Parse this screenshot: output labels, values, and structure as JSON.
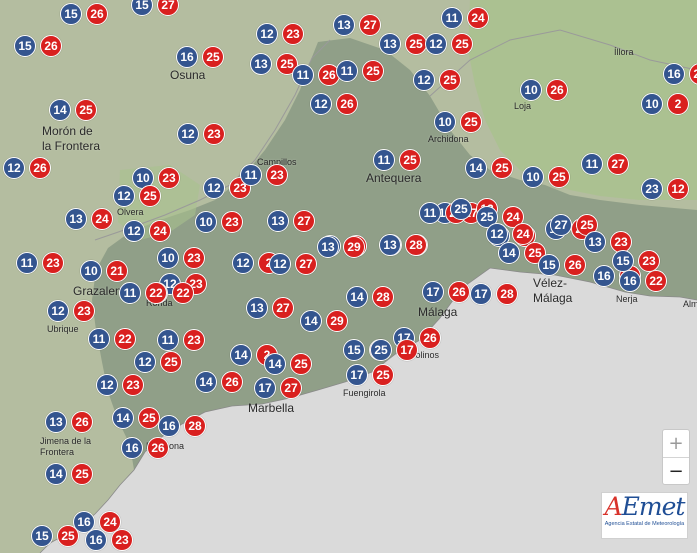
{
  "map": {
    "colors": {
      "sea": "#dadada",
      "land": "#b4bda0",
      "province": "#8c9b85",
      "highland": "#a9c28e",
      "border": "#9a9a9a",
      "min_marker": "#34558f",
      "max_marker": "#d9201f"
    },
    "town_labels": [
      "Osuna",
      "Morón de\nla Frontera",
      "Loja",
      "Íllora",
      "Archidona",
      "Campillos",
      "Antequera",
      "Olvera",
      "Grazalema",
      "Ronda",
      "Ubrique",
      "Vélez-\nMálaga",
      "Nerja",
      "Alm",
      "Málaga",
      "Molinos",
      "Marbella",
      "Fuengirola",
      "Jimena de la\nFrontera",
      "Estepona"
    ],
    "stations": [
      {
        "min": "15",
        "max": "26"
      },
      {
        "min": "15",
        "max": "27"
      },
      {
        "min": "15",
        "max": "26"
      },
      {
        "min": "16",
        "max": "25"
      },
      {
        "min": "12",
        "max": "23"
      },
      {
        "min": "13",
        "max": "27"
      },
      {
        "min": "11",
        "max": "24"
      },
      {
        "min": "13",
        "max": "25"
      },
      {
        "min": "12",
        "max": "25"
      },
      {
        "min": "16",
        "max": "25"
      },
      {
        "min": "13",
        "max": "25"
      },
      {
        "min": "11",
        "max": "26"
      },
      {
        "min": "11",
        "max": "25"
      },
      {
        "min": "12",
        "max": "25"
      },
      {
        "min": "10",
        "max": "26"
      },
      {
        "min": "10",
        "max": "2"
      },
      {
        "min": "14",
        "max": "25"
      },
      {
        "min": "12",
        "max": "26"
      },
      {
        "min": "10",
        "max": "25"
      },
      {
        "min": "12",
        "max": "23"
      },
      {
        "min": "11",
        "max": "25"
      },
      {
        "min": "12",
        "max": "26"
      },
      {
        "min": "14",
        "max": "25"
      },
      {
        "min": "11",
        "max": "27"
      },
      {
        "min": "10",
        "max": "25"
      },
      {
        "min": "23",
        "max": "12"
      },
      {
        "min": "10",
        "max": "23"
      },
      {
        "min": "12",
        "max": "23"
      },
      {
        "min": "11",
        "max": "23"
      },
      {
        "min": "12",
        "max": "25"
      },
      {
        "min": "10",
        "max": "23"
      },
      {
        "min": "10",
        "max": "23"
      },
      {
        "min": "12",
        "max": "24"
      },
      {
        "min": "11",
        "max": "27"
      },
      {
        "min": "13",
        "max": "24"
      },
      {
        "min": "11",
        "max": "23"
      },
      {
        "min": "13",
        "max": "27"
      },
      {
        "min": "11",
        "max": "26"
      },
      {
        "min": "25",
        "max": "12"
      },
      {
        "min": "13",
        "max": "27"
      },
      {
        "min": "25",
        "max": "24"
      },
      {
        "min": "12",
        "max": "23"
      },
      {
        "min": "11",
        "max": "24"
      },
      {
        "min": "10",
        "max": "21"
      },
      {
        "min": "12",
        "max": "23"
      },
      {
        "min": "12",
        "max": "2"
      },
      {
        "min": "12",
        "max": "27"
      },
      {
        "min": "13",
        "max": "29"
      },
      {
        "min": "13",
        "max": "28"
      },
      {
        "min": "14",
        "max": "25"
      },
      {
        "min": "15",
        "max": "26"
      },
      {
        "min": "16",
        "max": "23"
      },
      {
        "min": "12",
        "max": "22"
      },
      {
        "min": "11",
        "max": "22"
      },
      {
        "min": "12",
        "max": "23"
      },
      {
        "min": "13",
        "max": "27"
      },
      {
        "min": "14",
        "max": "28"
      },
      {
        "min": "17",
        "max": "26"
      },
      {
        "min": "17",
        "max": "28"
      },
      {
        "min": "16",
        "max": "22"
      },
      {
        "min": "11",
        "max": "22"
      },
      {
        "min": "11",
        "max": "23"
      },
      {
        "min": "14",
        "max": "29"
      },
      {
        "min": "17",
        "max": "26"
      },
      {
        "min": "12",
        "max": "25"
      },
      {
        "min": "14",
        "max": "2"
      },
      {
        "min": "14",
        "max": "25"
      },
      {
        "min": "15",
        "max": "24"
      },
      {
        "min": "25",
        "max": "17"
      },
      {
        "min": "12",
        "max": "23"
      },
      {
        "min": "14",
        "max": "26"
      },
      {
        "min": "17",
        "max": "27"
      },
      {
        "min": "17",
        "max": "25"
      },
      {
        "min": "13",
        "max": "26"
      },
      {
        "min": "14",
        "max": "25"
      },
      {
        "min": "16",
        "max": "28"
      },
      {
        "min": "16",
        "max": "26"
      },
      {
        "min": "14",
        "max": "25"
      },
      {
        "min": "16",
        "max": "24"
      },
      {
        "min": "15",
        "max": "25"
      },
      {
        "min": "16",
        "max": "23"
      },
      {
        "min": "13",
        "max": "27"
      },
      {
        "min": "27",
        "max": "25"
      },
      {
        "min": "13",
        "max": "23"
      },
      {
        "min": "15",
        "max": "23"
      },
      {
        "min": "12",
        "max": "24"
      }
    ]
  },
  "zoom": {
    "in_label": "+",
    "out_label": "−"
  },
  "logo": {
    "brand_a": "A",
    "brand_rest": "Emet",
    "tagline": "Agencia Estatal de Meteorología"
  }
}
